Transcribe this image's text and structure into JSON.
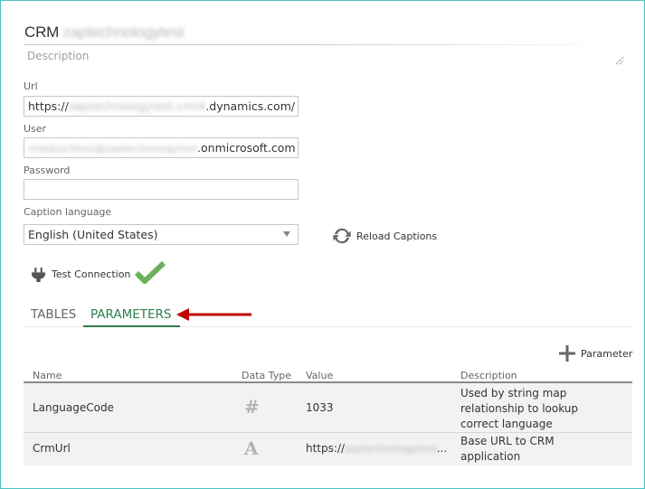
{
  "header": {
    "title_prefix": "CRM",
    "title_redacted": "zaptechnologytest",
    "description_placeholder": "Description"
  },
  "form": {
    "url": {
      "label": "Url",
      "value_prefix": "https://",
      "value_redacted": "zaptechnologytest.crm4",
      "value_suffix": ".dynamics.com/"
    },
    "user": {
      "label": "User",
      "value_redacted": "mladuschtest@zaptechnologytest",
      "value_suffix": ".onmicrosoft.com"
    },
    "password": {
      "label": "Password",
      "value": ""
    },
    "caption_language": {
      "label": "Caption language",
      "selected": "English (United States)"
    },
    "reload_captions_label": "Reload Captions",
    "test_connection_label": "Test Connection",
    "connection_status": "success"
  },
  "tabs": [
    {
      "label": "TABLES",
      "active": false
    },
    {
      "label": "PARAMETERS",
      "active": true
    }
  ],
  "parameters": {
    "add_label": "Parameter",
    "columns": [
      "Name",
      "Data Type",
      "Value",
      "Description"
    ],
    "rows": [
      {
        "name": "LanguageCode",
        "data_type": "number",
        "data_type_glyph": "#",
        "value": "1033",
        "description": "Used by string map relationship to lookup correct language"
      },
      {
        "name": "CrmUrl",
        "data_type": "text",
        "data_type_glyph": "A",
        "value_prefix": "https://",
        "value_redacted": "zaptechnologytest",
        "value_suffix": "...",
        "description": "Base URL to CRM application"
      }
    ]
  },
  "colors": {
    "frame_border": "#4cc3c3",
    "accent_green": "#2e7d4f",
    "check_green": "#6ab15c",
    "annotation_arrow": "#c00000"
  }
}
